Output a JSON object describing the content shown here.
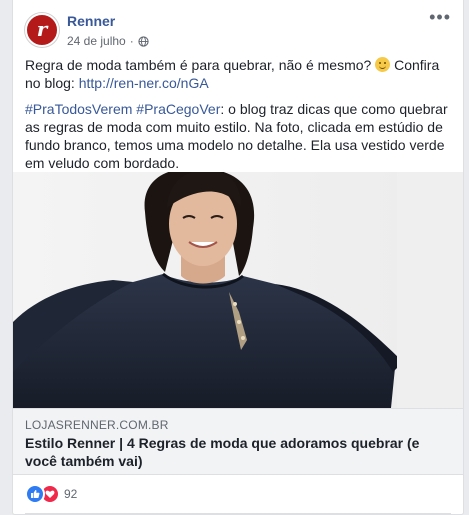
{
  "post": {
    "page_name": "Renner",
    "avatar_letter": "r",
    "date": "24 de julho",
    "paragraph1_text": "Regra de moda também é para quebrar, não é mesmo?",
    "paragraph1_after_emoji": " Confira no blog: ",
    "paragraph1_link": "http://ren-ner.co/nGA",
    "hashtag1": "#PraTodosVerem",
    "hashtag2": "#PraCegoVer",
    "paragraph2_text": ": o blog traz dicas que como quebrar as regras de moda com muito estilo. Na foto, clicada em estúdio de fundo branco, temos uma modelo no detalhe. Ela usa vestido verde em veludo com bordado."
  },
  "link_preview": {
    "domain": "LOJASRENNER.COM.BR",
    "title": "Estilo Renner | 4 Regras de moda que adoramos quebrar (e você também vai)"
  },
  "reactions": {
    "count": "92"
  },
  "icons": {
    "privacy": "globe-icon",
    "menu": "more-options-icon",
    "like": "like-icon",
    "love": "love-icon",
    "emoji": "smile-emoji-icon"
  },
  "colors": {
    "link": "#385898",
    "avatar": "#b51a1a",
    "like": "#2e7bf3",
    "love": "#f0284a"
  }
}
